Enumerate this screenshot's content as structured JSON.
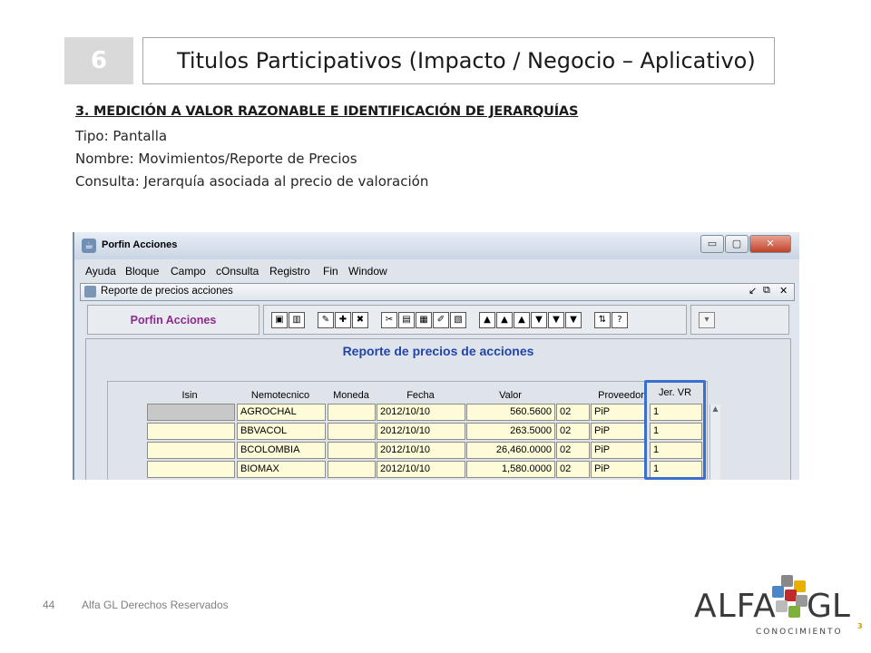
{
  "slide": {
    "number": "6",
    "title": "Titulos Participativos (Impacto / Negocio – Aplicativo)",
    "heading": "3. MEDICIÓN A VALOR RAZONABLE E IDENTIFICACIÓN DE JERARQUÍAS",
    "info": [
      "Tipo: Pantalla",
      "Nombre: Movimientos/Reporte de Precios",
      "Consulta: Jerarquía asociada al precio de valoración"
    ]
  },
  "window": {
    "title": "Porfin Acciones",
    "controls": {
      "minimize": "▭",
      "maximize": "▢",
      "close": "✕"
    },
    "menu": [
      "Ayuda",
      "Bloque",
      "Campo",
      "cOnsulta",
      "Registro",
      "Fin",
      "Window"
    ],
    "child": {
      "title": "Reporte de precios acciones",
      "controls": {
        "minimize": "↙",
        "restore": "⧉",
        "close": "✕"
      }
    },
    "label": "Porfin Acciones",
    "toolbar_icons": [
      "save-icon",
      "exit-icon",
      "open-icon",
      "add-icon",
      "delete-icon",
      "cut-icon",
      "copy-icon",
      "paste-icon",
      "edit-icon",
      "print-icon",
      "first-icon",
      "prev-block-icon",
      "prev-icon",
      "next-icon",
      "next-block-icon",
      "last-icon",
      "refresh-icon",
      "help-icon"
    ],
    "toolbar_glyphs": [
      "▣",
      "▥",
      "✎",
      "✚",
      "✖",
      "✂",
      "▤",
      "▦",
      "✐",
      "▧",
      "▲",
      "▲",
      "▲",
      "▼",
      "▼",
      "▼",
      "⇅",
      "?"
    ],
    "dropdown_glyph": "▾",
    "form_title": "Reporte de precios de acciones",
    "columns": {
      "isin": "Isin",
      "nemotecnico": "Nemotecnico",
      "moneda": "Moneda",
      "fecha": "Fecha",
      "valor": "Valor",
      "proveedor": "Proveedor",
      "jerarquia": "Jer. VR"
    },
    "rows": [
      {
        "isin": "",
        "nemotecnico": "AGROCHAL",
        "moneda": "",
        "fecha": "2012/10/10",
        "valor": "560.5600",
        "prov_code": "02",
        "prov_name": "PiP",
        "jer": "1"
      },
      {
        "isin": "",
        "nemotecnico": "BBVACOL",
        "moneda": "",
        "fecha": "2012/10/10",
        "valor": "263.5000",
        "prov_code": "02",
        "prov_name": "PiP",
        "jer": "1"
      },
      {
        "isin": "",
        "nemotecnico": "BCOLOMBIA",
        "moneda": "",
        "fecha": "2012/10/10",
        "valor": "26,460.0000",
        "prov_code": "02",
        "prov_name": "PiP",
        "jer": "1"
      },
      {
        "isin": "",
        "nemotecnico": "BIOMAX",
        "moneda": "",
        "fecha": "2012/10/10",
        "valor": "1,580.0000",
        "prov_code": "02",
        "prov_name": "PiP",
        "jer": "1"
      }
    ]
  },
  "footer": {
    "page": "44",
    "text": "Alfa GL Derechos Reservados"
  },
  "logo": {
    "alfa": "ALFA",
    "gl": "GL",
    "sub": "CONOCIMIENTO",
    "sup": "3"
  },
  "colors": {
    "highlight": "#3a6fd0",
    "form_title": "#2244aa",
    "label": "#8b2b8b",
    "cell": "#fdfbd8"
  }
}
